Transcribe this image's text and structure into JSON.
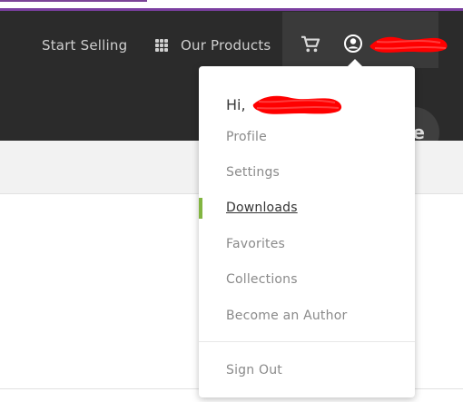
{
  "nav": {
    "start_selling": "Start Selling",
    "our_products": "Our Products"
  },
  "hero": {
    "button_text": "e"
  },
  "dropdown": {
    "greeting": "Hi,",
    "items": [
      {
        "label": "Profile"
      },
      {
        "label": "Settings"
      },
      {
        "label": "Downloads"
      },
      {
        "label": "Favorites"
      },
      {
        "label": "Collections"
      },
      {
        "label": "Become an Author"
      }
    ],
    "sign_out": "Sign Out"
  },
  "colors": {
    "active_indicator": "#82b541",
    "navbar_bg": "#2b2b2b",
    "redaction": "#ff0000",
    "accent_line": "#7b3fa0"
  },
  "icons": [
    "grid-icon",
    "cart-icon",
    "user-icon"
  ]
}
